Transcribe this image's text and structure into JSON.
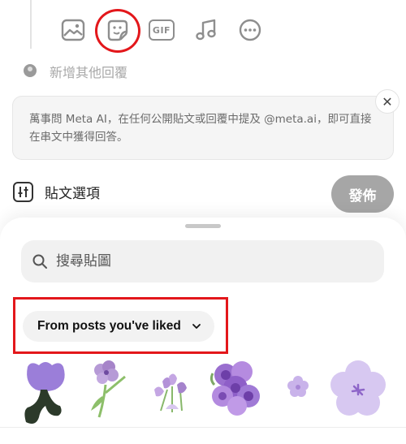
{
  "composer": {
    "tools": [
      "image-icon",
      "sticker-icon",
      "gif-icon",
      "music-icon",
      "more-icon"
    ],
    "gif_label": "GIF",
    "add_reply": "新增其他回覆"
  },
  "meta_ai": {
    "text": "萬事問 Meta AI，在任何公開貼文或回覆中提及 @meta.ai，即可直接在串文中獲得回答。",
    "close_symbol": "✕"
  },
  "post_options_label": "貼文選項",
  "publish_label": "發佈",
  "sticker_sheet": {
    "search_placeholder": "搜尋貼圖",
    "filter_label": "From posts you've liked",
    "stickers": [
      "purple-tulip-sticker",
      "violet-flower-sticker",
      "crocus-bouquet-sticker",
      "rose-cluster-sticker",
      "small-lilac-flower-sticker",
      "lilac-blossom-sticker"
    ]
  },
  "colors": {
    "highlight": "#e3171b",
    "icon_gray": "#8e8e8e",
    "publish_bg": "#a6a6a6"
  }
}
